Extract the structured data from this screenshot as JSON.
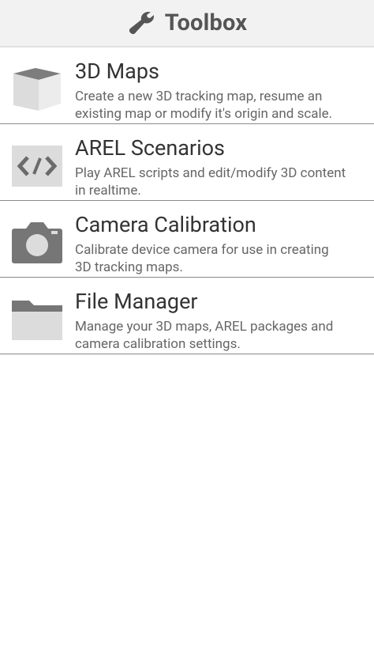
{
  "header": {
    "title": "Toolbox",
    "icon": "wrench-icon"
  },
  "items": [
    {
      "title": "3D Maps",
      "desc_line1": "Create a new 3D tracking map, resume an",
      "desc_line2": "existing map or modify it's origin and scale.",
      "icon": "cube-icon"
    },
    {
      "title": "AREL Scenarios",
      "desc_line1": "Play AREL scripts and edit/modify 3D content",
      "desc_line2": "in realtime.",
      "icon": "code-icon"
    },
    {
      "title": "Camera Calibration",
      "desc_line1": "Calibrate device camera for use in creating",
      "desc_line2": "3D tracking maps.",
      "icon": "camera-icon"
    },
    {
      "title": "File Manager",
      "desc_line1": "Manage your 3D maps, AREL packages and",
      "desc_line2": "camera calibration settings.",
      "icon": "folder-icon"
    }
  ],
  "colors": {
    "header_bg": "#f2f2f2",
    "title_text": "#333333",
    "desc_text": "#666666",
    "divider": "#8a8a8a"
  }
}
